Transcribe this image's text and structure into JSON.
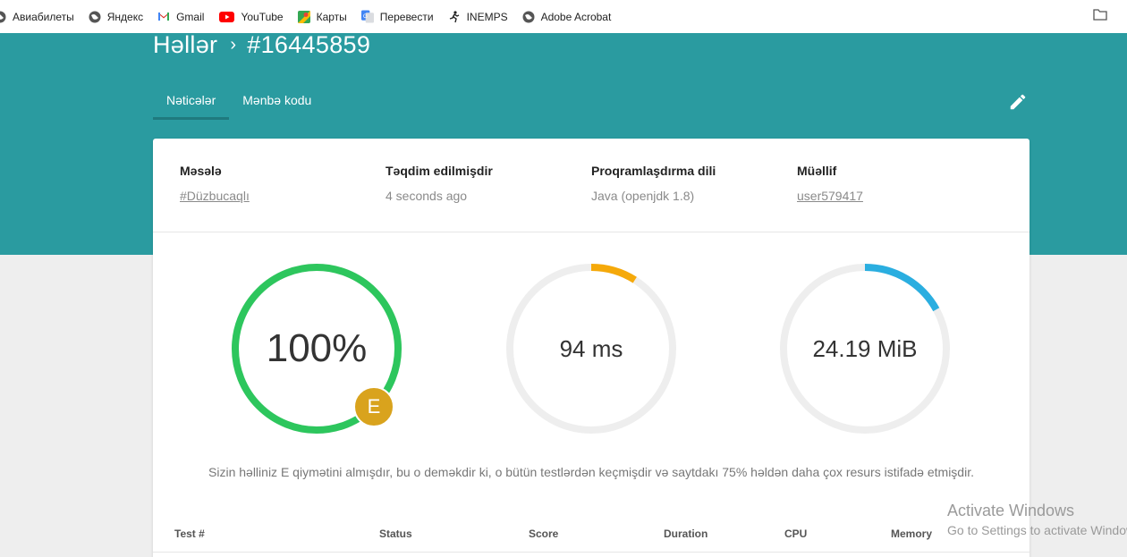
{
  "bookmarks": [
    {
      "label": "Авиабилеты",
      "icon": "globe-icon"
    },
    {
      "label": "Яндекс",
      "icon": "globe-icon"
    },
    {
      "label": "Gmail",
      "icon": "gmail-icon"
    },
    {
      "label": "YouTube",
      "icon": "youtube-icon"
    },
    {
      "label": "Карты",
      "icon": "maps-icon"
    },
    {
      "label": "Перевести",
      "icon": "translate-icon"
    },
    {
      "label": "INEMPS",
      "icon": "runner-icon"
    },
    {
      "label": "Adobe Acrobat",
      "icon": "globe-icon"
    }
  ],
  "header": {
    "breadcrumb_root": "Həllər",
    "submission_id": "#16445859",
    "tabs": [
      "Nəticələr",
      "Mənbə kodu"
    ],
    "active_tab": "Nəticələr"
  },
  "meta": [
    {
      "label": "Məsələ",
      "value": "#Düzbucaqlı",
      "link": true
    },
    {
      "label": "Təqdim edilmişdir",
      "value": "4 seconds ago",
      "link": false
    },
    {
      "label": "Proqramlaşdırma dili",
      "value": "Java (openjdk 1.8)",
      "link": false
    },
    {
      "label": "Müəllif",
      "value": "user579417",
      "link": true
    }
  ],
  "results": {
    "score": {
      "text": "100%",
      "fraction": 1.0,
      "color": "#2dc65d"
    },
    "grade": "E",
    "time": {
      "text": "94 ms",
      "fraction": 0.09,
      "color": "#f5a90a"
    },
    "memory": {
      "text": "24.19 MiB",
      "fraction": 0.17,
      "color": "#2aaee0"
    },
    "summary": "Sizin həlliniz E qiymətini almışdır, bu o deməkdir ki, o bütün testlərdən keçmişdir və saytdakı 75% həldən daha çox resurs istifadə etmişdir."
  },
  "table": {
    "columns": [
      "Test #",
      "Status",
      "Score",
      "Duration",
      "CPU",
      "Memory"
    ]
  },
  "watermark": {
    "line1": "Activate Windows",
    "line2": "Go to Settings to activate Windows."
  }
}
